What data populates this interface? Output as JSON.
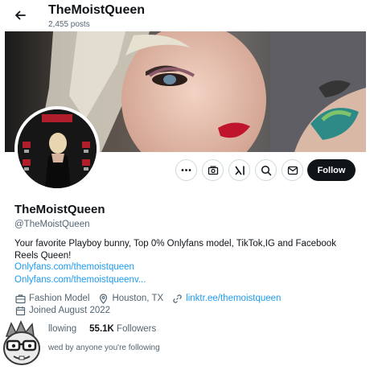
{
  "header": {
    "title": "TheMoistQueen",
    "post_count": "2,455 posts"
  },
  "profile": {
    "display_name": "TheMoistQueen",
    "handle": "@TheMoistQueen",
    "bio": "Your favorite Playboy bunny, Top 0% Onlyfans model, TikTok,IG and Facebook Reels Queen!",
    "links": [
      "Onlyfans.com/themoistqueen",
      "Onlyfans.com/themoistqueenv..."
    ],
    "category": "Fashion Model",
    "location": "Houston, TX",
    "website": "linktr.ee/themoistqueen",
    "joined": "Joined August 2022"
  },
  "actions": {
    "follow_label": "Follow",
    "buttons": [
      "more-icon",
      "subscribe-icon",
      "grok-icon",
      "search-icon",
      "message-icon"
    ]
  },
  "stats": {
    "following_label": "llowing",
    "followers_count": "55.1K",
    "followers_label": "Followers",
    "followed_by": "wed by anyone you're following"
  },
  "colors": {
    "link": "#1d9bf0",
    "text": "#0f1419",
    "secondary": "#536471",
    "follow_bg": "#0f1419"
  }
}
